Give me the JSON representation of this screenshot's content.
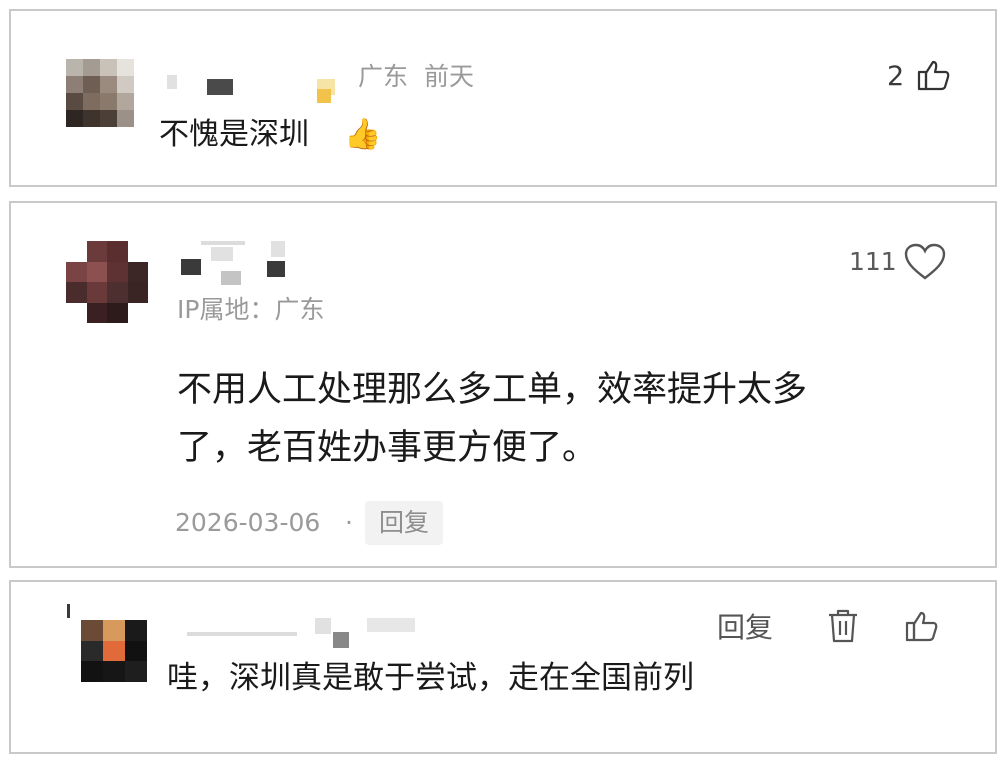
{
  "comments": [
    {
      "location": "广东",
      "time": "前天",
      "like_count": "2",
      "text": "不愧是深圳",
      "emoji": "👍"
    },
    {
      "like_count": "111",
      "ip_label": "IP属地：广东",
      "text_line1": "不用人工处理那么多工单，效率提升太多",
      "text_line2": "了，老百姓办事更方便了。",
      "date": "2026-03-06",
      "separator": "·",
      "reply_label": "回复"
    },
    {
      "reply_label": "回复",
      "text": "哇，深圳真是敢于尝试，走在全国前列"
    }
  ],
  "colors": {
    "border": "#c9c9c9",
    "muted": "#9a9a9a",
    "text": "#1a1a1a"
  },
  "icons": [
    "thumbs-up-icon",
    "heart-icon",
    "trash-icon",
    "thumbs-up-outline-icon"
  ]
}
